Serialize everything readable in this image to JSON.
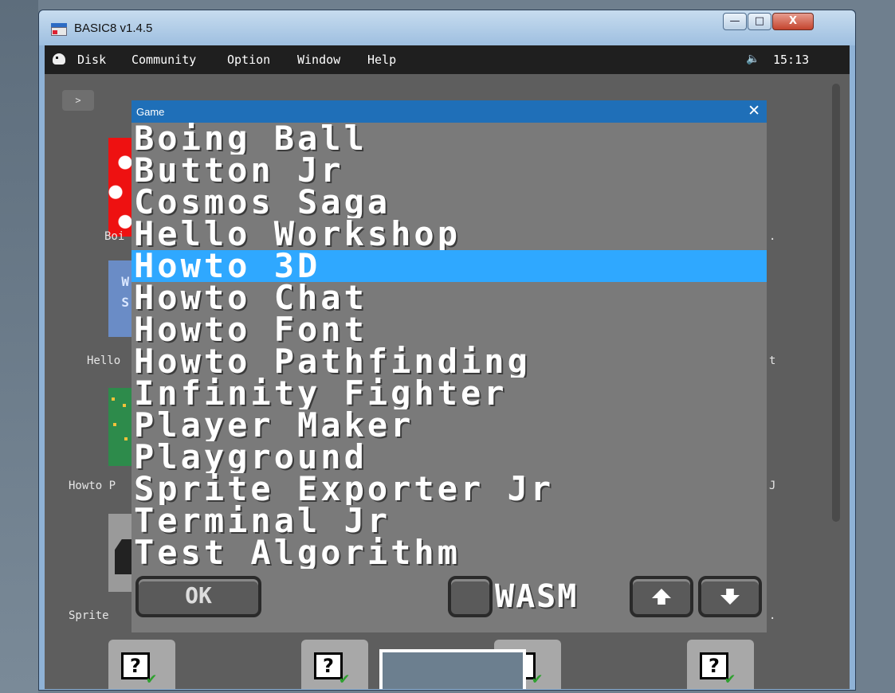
{
  "window": {
    "title": "BASIC8 v1.4.5",
    "minimize": "—",
    "maximize": "□",
    "close": "X"
  },
  "menubar": {
    "items": [
      "Disk",
      "Community",
      "Option",
      "Window",
      "Help"
    ],
    "volume_icon": "speaker-icon",
    "clock": "15:13"
  },
  "desktop": {
    "prompt_button": ">",
    "left_labels": [
      "Boi",
      "Hello",
      "Howto P",
      "Sprite"
    ],
    "right_labels": [
      ".",
      "t",
      "J",
      "."
    ]
  },
  "dialog": {
    "title": "Game",
    "close": "✕",
    "items": [
      "Boing Ball",
      "Button Jr",
      "Cosmos Saga",
      "Hello Workshop",
      "Howto 3D",
      "Howto Chat",
      "Howto Font",
      "Howto Pathfinding",
      "Infinity Fighter",
      "Player Maker",
      "Playground",
      "Sprite Exporter Jr",
      "Terminal Jr",
      "Test Algorithm"
    ],
    "selected_index": 4,
    "ok": "OK",
    "wasm_label": "WASM",
    "wasm_checked": false
  },
  "tiles": {
    "glyph": "?",
    "check": "✔"
  },
  "colors": {
    "selection": "#2fa8ff",
    "dialog_title": "#1f6fb8",
    "menubar": "#1f1f1f"
  }
}
